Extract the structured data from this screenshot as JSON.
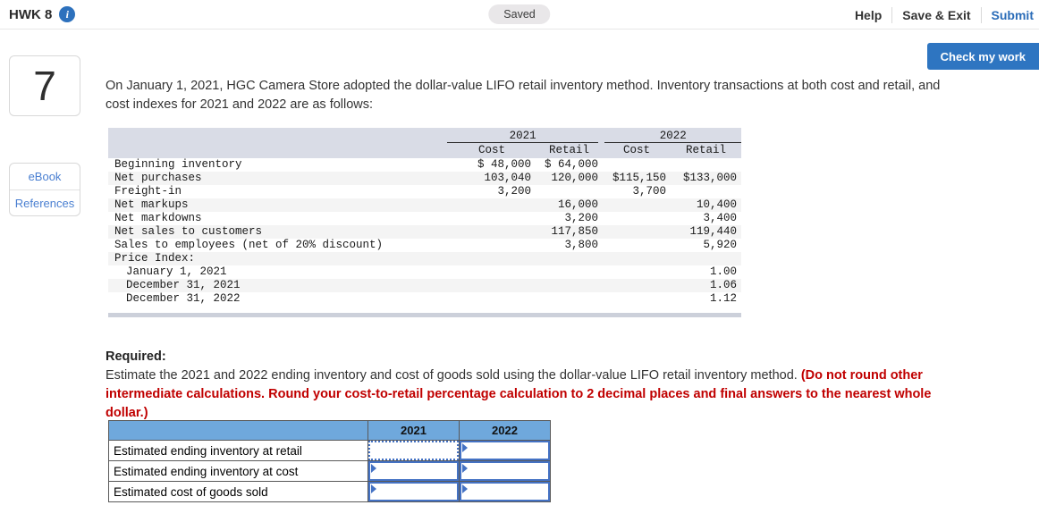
{
  "topbar": {
    "title": "HWK 8",
    "saved_label": "Saved",
    "help_label": "Help",
    "save_exit_label": "Save & Exit",
    "submit_label": "Submit"
  },
  "check_my_work_label": "Check my work",
  "sidebar": {
    "question_number": "7",
    "ebook_label": "eBook",
    "references_label": "References"
  },
  "problem": {
    "intro": "On January 1, 2021, HGC Camera Store adopted the dollar-value LIFO retail inventory method. Inventory transactions at both cost and retail, and cost indexes for 2021 and 2022 are as follows:"
  },
  "data_table": {
    "year_headers": [
      "2021",
      "2022"
    ],
    "sub_headers": [
      "Cost",
      "Retail",
      "Cost",
      "Retail"
    ],
    "rows": [
      {
        "label": "Beginning inventory",
        "indent": 0,
        "c1": "$ 48,000",
        "r1": "$ 64,000",
        "c2": "",
        "r2": ""
      },
      {
        "label": "Net purchases",
        "indent": 0,
        "c1": "103,040",
        "r1": "120,000",
        "c2": "$115,150",
        "r2": "$133,000"
      },
      {
        "label": "Freight-in",
        "indent": 0,
        "c1": "3,200",
        "r1": "",
        "c2": "3,700",
        "r2": ""
      },
      {
        "label": "Net markups",
        "indent": 0,
        "c1": "",
        "r1": "16,000",
        "c2": "",
        "r2": "10,400"
      },
      {
        "label": "Net markdowns",
        "indent": 0,
        "c1": "",
        "r1": "3,200",
        "c2": "",
        "r2": "3,400"
      },
      {
        "label": "Net sales to customers",
        "indent": 0,
        "c1": "",
        "r1": "117,850",
        "c2": "",
        "r2": "119,440"
      },
      {
        "label": "Sales to employees (net of 20% discount)",
        "indent": 0,
        "c1": "",
        "r1": "3,800",
        "c2": "",
        "r2": "5,920"
      },
      {
        "label": "Price Index:",
        "indent": 0,
        "c1": "",
        "r1": "",
        "c2": "",
        "r2": ""
      },
      {
        "label": "January 1, 2021",
        "indent": 1,
        "c1": "",
        "r1": "",
        "c2": "",
        "r2": "1.00"
      },
      {
        "label": "December 31, 2021",
        "indent": 1,
        "c1": "",
        "r1": "",
        "c2": "",
        "r2": "1.06"
      },
      {
        "label": "December 31, 2022",
        "indent": 1,
        "c1": "",
        "r1": "",
        "c2": "",
        "r2": "1.12"
      }
    ]
  },
  "required": {
    "heading": "Required:",
    "text_black": "Estimate the 2021 and 2022 ending inventory and cost of goods sold using the dollar-value LIFO retail inventory method. ",
    "text_red": "(Do not round other intermediate calculations. Round your cost-to-retail percentage calculation to 2 decimal places and final answers to the nearest whole dollar.)"
  },
  "answer_table": {
    "col_headers": [
      "2021",
      "2022"
    ],
    "rows": [
      {
        "label": "Estimated ending inventory at retail",
        "v2021": "",
        "v2022": "",
        "focused": "2021"
      },
      {
        "label": "Estimated ending inventory at cost",
        "v2021": "",
        "v2022": "",
        "focused": ""
      },
      {
        "label": "Estimated cost of goods sold",
        "v2021": "",
        "v2022": "",
        "focused": ""
      }
    ]
  },
  "colors": {
    "accent_blue": "#2e75c1",
    "link_blue": "#4a7fd1",
    "answer_header_blue": "#6fa8dc",
    "input_border_blue": "#4472c4",
    "required_red": "#c00000",
    "table_header_bg": "#d9dce6"
  }
}
